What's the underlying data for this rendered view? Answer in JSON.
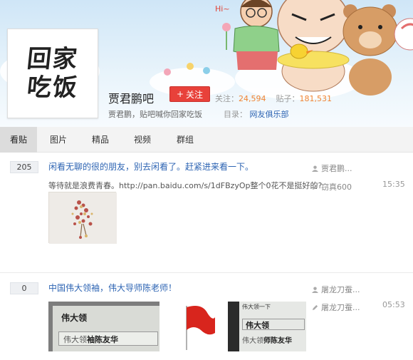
{
  "header": {
    "logo_lines": [
      "回家",
      "吃饭"
    ],
    "forum_name": "贾君鹏吧",
    "follow_label": "关注",
    "follow_prefix": "+",
    "stats": {
      "follow_label": "关注：",
      "follow_count": "24,594",
      "posts_label": "贴子：",
      "posts_count": "181,531"
    },
    "slogan": "贾君鹏，贴吧喊你回家吃饭",
    "catalog_label": "目录：",
    "catalog_value": "网友俱乐部",
    "banner_greeting": "Hi~"
  },
  "tabs": [
    {
      "label": "看贴",
      "active": true
    },
    {
      "label": "图片",
      "active": false
    },
    {
      "label": "精品",
      "active": false
    },
    {
      "label": "视频",
      "active": false
    },
    {
      "label": "群组",
      "active": false
    }
  ],
  "posts": [
    {
      "reply_count": "205",
      "title": "闲看无聊的很的朋友，别去闲看了。赶紧进来看一下。",
      "abstract": "等待就是浪费青春。http://pan.baidu.com/s/1dFBzyOp整个0花不是挺好的?",
      "author": "贾君鹏...",
      "last_reply_user": "窃真600",
      "time": "15:35"
    },
    {
      "reply_count": "0",
      "title": "中国伟大领袖，伟大导师陈老师！",
      "abstract": "",
      "author": "屠龙刀蚕...",
      "last_reply_user": "屠龙刀蚕...",
      "time": "05:53",
      "image_texts": {
        "img1_line1": "伟大领",
        "img1_line2_a": "伟大领",
        "img1_line2_b": "袖陈友华",
        "img3_top": "伟大领一下",
        "img3_line1": "伟大领",
        "img3_line2_a": "伟大领",
        "img3_line2_b": "师陈友华"
      }
    }
  ],
  "colors": {
    "accent": "#2d64b3",
    "follow_button": "#e8413a",
    "stat_value": "#f08433"
  },
  "icons": {
    "author": "user-icon",
    "last_reply": "pen-icon"
  }
}
